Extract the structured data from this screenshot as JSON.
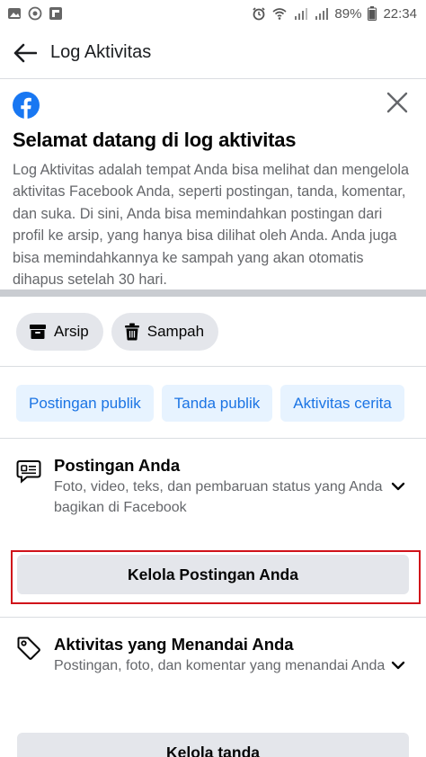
{
  "status_bar": {
    "battery": "89%",
    "time": "22:34"
  },
  "app_bar": {
    "title": "Log Aktivitas"
  },
  "welcome": {
    "title": "Selamat datang di log aktivitas",
    "body": "Log Aktivitas adalah tempat Anda bisa melihat dan mengelola aktivitas Facebook Anda, seperti postingan, tanda, komentar, dan suka. Di sini, Anda bisa memindahkan postingan dari profil ke arsip, yang hanya bisa dilihat oleh Anda. Anda juga bisa memindahkannya ke sampah yang akan otomatis dihapus setelah 30 hari."
  },
  "chips": [
    {
      "label": "Arsip",
      "icon": "archive-icon"
    },
    {
      "label": "Sampah",
      "icon": "trash-icon"
    }
  ],
  "tabs": [
    {
      "label": "Postingan publik"
    },
    {
      "label": "Tanda publik"
    },
    {
      "label": "Aktivitas cerita"
    }
  ],
  "sections": [
    {
      "title": "Postingan Anda",
      "description": "Foto, video, teks, dan pembaruan status yang Anda bagikan di Facebook",
      "button": "Kelola Postingan Anda",
      "icon": "speech-bubble-icon"
    },
    {
      "title": "Aktivitas yang Menandai Anda",
      "description": "Postingan, foto, dan komentar yang menandai Anda",
      "button": "Kelola tanda",
      "icon": "tag-icon"
    }
  ],
  "colors": {
    "accent": "#1b74e4",
    "facebook_blue": "#1877f2",
    "highlight": "#d0121a",
    "button_bg": "#e4e6eb",
    "tab_bg": "#e7f3ff"
  }
}
